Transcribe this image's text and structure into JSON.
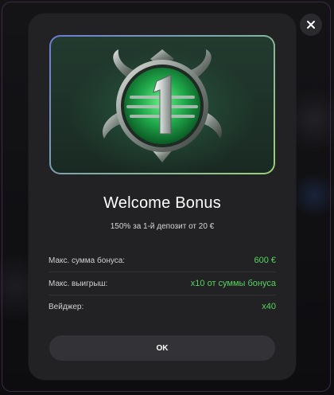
{
  "modal": {
    "title": "Welcome Bonus",
    "subtitle": "150% за 1-й депозит от 20 €",
    "details": [
      {
        "label": "Макс. сумма бонуса:",
        "value": "600 €"
      },
      {
        "label": "Макс. выигрыш:",
        "value": "x10 от суммы бонуса"
      },
      {
        "label": "Вейджер:",
        "value": "x40"
      }
    ],
    "ok_label": "OK"
  },
  "hero": {
    "medal_number": "1",
    "icon": "medal-number-one-icon"
  },
  "close": {
    "icon": "close-icon"
  },
  "colors": {
    "accent_green": "#55d45c",
    "modal_bg": "#222225",
    "button_bg": "#333337"
  }
}
